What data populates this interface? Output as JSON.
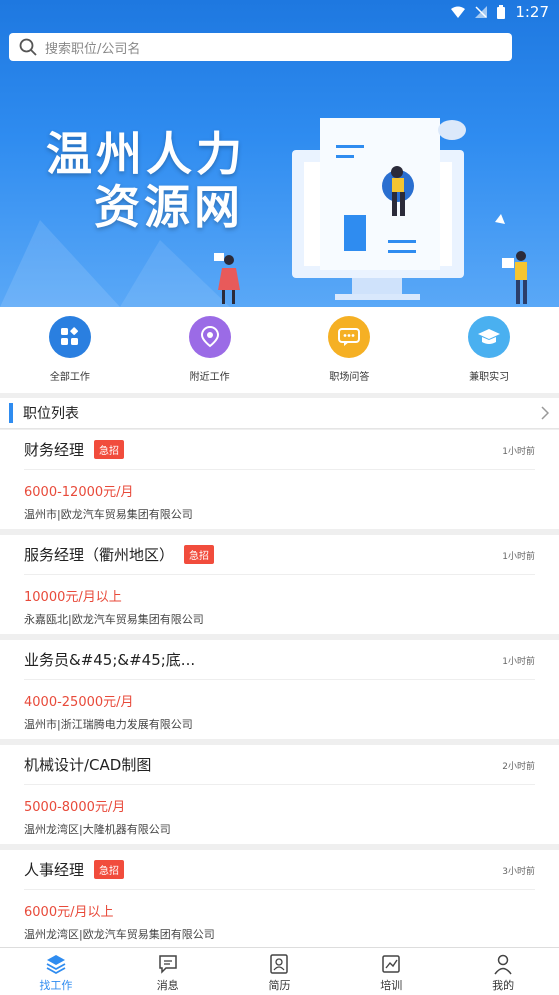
{
  "status_bar": {
    "time": "1:27"
  },
  "search": {
    "placeholder": "搜索职位/公司名"
  },
  "banner": {
    "title_line1": "温州人力",
    "title_line2": "资源网"
  },
  "quick_nav": [
    {
      "label": "全部工作",
      "icon": "grid-icon",
      "color": "#2a7fe0"
    },
    {
      "label": "附近工作",
      "icon": "location-pin-icon",
      "color": "#9b6be6"
    },
    {
      "label": "职场问答",
      "icon": "chat-bubble-icon",
      "color": "#f5b024"
    },
    {
      "label": "兼职实习",
      "icon": "graduation-cap-icon",
      "color": "#4ab0f0"
    }
  ],
  "section": {
    "title": "职位列表"
  },
  "jobs": [
    {
      "title": "财务经理",
      "badge": "急招",
      "time": "1小时前",
      "salary": "6000-12000元/月",
      "company": "温州市|欧龙汽车贸易集团有限公司"
    },
    {
      "title": "服务经理（衢州地区）",
      "badge": "急招",
      "time": "1小时前",
      "salary": "10000元/月以上",
      "company": "永嘉瓯北|欧龙汽车贸易集团有限公司"
    },
    {
      "title": "业务员&#45;&#45;底...",
      "badge": "",
      "time": "1小时前",
      "salary": "4000-25000元/月",
      "company": "温州市|浙江瑞腾电力发展有限公司"
    },
    {
      "title": "机械设计/CAD制图",
      "badge": "",
      "time": "2小时前",
      "salary": "5000-8000元/月",
      "company": "温州龙湾区|大隆机器有限公司"
    },
    {
      "title": "人事经理",
      "badge": "急招",
      "time": "3小时前",
      "salary": "6000元/月以上",
      "company": "温州龙湾区|欧龙汽车贸易集团有限公司"
    }
  ],
  "tabs": [
    {
      "label": "找工作",
      "icon": "layers-icon",
      "active": true
    },
    {
      "label": "消息",
      "icon": "message-icon",
      "active": false
    },
    {
      "label": "简历",
      "icon": "resume-icon",
      "active": false
    },
    {
      "label": "培训",
      "icon": "chart-icon",
      "active": false
    },
    {
      "label": "我的",
      "icon": "user-icon",
      "active": false
    }
  ],
  "colors": {
    "accent": "#2f8cf0",
    "urgent": "#f14c3c",
    "salary": "#e84a3a"
  }
}
